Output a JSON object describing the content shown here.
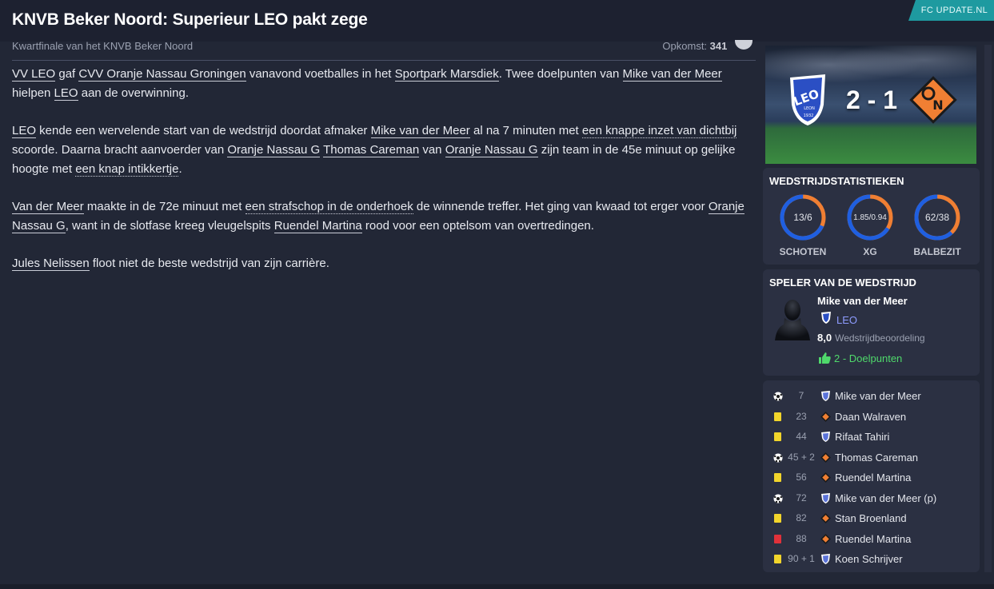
{
  "header": {
    "title": "KNVB Beker Noord: Superieur LEO pakt zege",
    "source": "FC UPDATE.NL"
  },
  "subline": {
    "competition": "Kwartfinale van het KNVB Beker Noord",
    "attendance_label": "Opkomst:",
    "attendance_value": "341"
  },
  "article": {
    "p1": [
      {
        "t": "VV LEO",
        "link": true
      },
      {
        "t": " gaf "
      },
      {
        "t": "CVV Oranje Nassau Groningen",
        "link": true
      },
      {
        "t": " vanavond voetballes in het "
      },
      {
        "t": "Sportpark Marsdiek",
        "link": true
      },
      {
        "t": ". Twee doelpunten van "
      },
      {
        "t": "Mike van der Meer",
        "link": true
      },
      {
        "t": " hielpen "
      },
      {
        "t": "LEO",
        "link": true
      },
      {
        "t": " aan de overwinning."
      }
    ],
    "p2": [
      {
        "t": "LEO",
        "link": true
      },
      {
        "t": " kende een wervelende start van de wedstrijd doordat afmaker "
      },
      {
        "t": "Mike van der Meer",
        "link": true
      },
      {
        "t": " al na 7 minuten met "
      },
      {
        "t": "een knappe inzet van dichtbij",
        "dotted": true
      },
      {
        "t": " scoorde. Daarna bracht aanvoerder van "
      },
      {
        "t": "Oranje Nassau G",
        "link": true
      },
      {
        "t": " "
      },
      {
        "t": "Thomas Careman",
        "link": true
      },
      {
        "t": " van "
      },
      {
        "t": "Oranje Nassau G",
        "link": true
      },
      {
        "t": " zijn team in de 45e minuut op gelijke hoogte met "
      },
      {
        "t": "een knap intikkertje",
        "dotted": true
      },
      {
        "t": "."
      }
    ],
    "p3": [
      {
        "t": "Van der Meer",
        "link": true
      },
      {
        "t": " maakte in de 72e minuut met "
      },
      {
        "t": "een strafschop in de onderhoek",
        "dotted": true
      },
      {
        "t": " de winnende treffer. Het ging van kwaad tot erger voor "
      },
      {
        "t": "Oranje Nassau G",
        "link": true
      },
      {
        "t": ", want in de slotfase kreeg vleugelspits "
      },
      {
        "t": "Ruendel Martina",
        "link": true
      },
      {
        "t": " rood voor een optelsom van overtredingen."
      }
    ],
    "p4": [
      {
        "t": "Jules Nelissen",
        "link": true
      },
      {
        "t": " floot niet de beste wedstrijd van zijn carrière."
      }
    ]
  },
  "score": {
    "home": "2",
    "away": "1",
    "separator": "-",
    "home_crest_text": "LEO",
    "home_crest_sub": "LEON",
    "home_crest_year": "1932",
    "away_crest_text": "N"
  },
  "stats": {
    "title": "WEDSTRIJDSTATISTIEKEN",
    "items": [
      {
        "label": "SCHOTEN",
        "value": "13/6",
        "home_fraction": 0.684
      },
      {
        "label": "XG",
        "value": "1.85/0.94",
        "home_fraction": 0.663
      },
      {
        "label": "BALBEZIT",
        "value": "62/38",
        "home_fraction": 0.62
      }
    ],
    "home_color": "#1f5fe0",
    "away_color": "#f07f33"
  },
  "potm": {
    "title": "SPELER VAN DE WEDSTRIJD",
    "name": "Mike van der Meer",
    "team": "LEO",
    "rating": "8,0",
    "rating_label": "Wedstrijdbeoordeling",
    "goals": "2 - Doelpunten"
  },
  "events": [
    {
      "type": "goal",
      "minute": "7",
      "team": "home",
      "player": "Mike van der Meer"
    },
    {
      "type": "yellow",
      "minute": "23",
      "team": "away",
      "player": "Daan Walraven"
    },
    {
      "type": "yellow",
      "minute": "44",
      "team": "home",
      "player": "Rifaat Tahiri"
    },
    {
      "type": "goal",
      "minute": "45 + 2",
      "team": "away",
      "player": "Thomas Careman"
    },
    {
      "type": "yellow",
      "minute": "56",
      "team": "away",
      "player": "Ruendel Martina"
    },
    {
      "type": "goal",
      "minute": "72",
      "team": "home",
      "player": "Mike van der Meer (p)"
    },
    {
      "type": "yellow",
      "minute": "82",
      "team": "away",
      "player": "Stan Broenland"
    },
    {
      "type": "red",
      "minute": "88",
      "team": "away",
      "player": "Ruendel Martina"
    },
    {
      "type": "yellow",
      "minute": "90 + 1",
      "team": "home",
      "player": "Koen Schrijver"
    }
  ]
}
